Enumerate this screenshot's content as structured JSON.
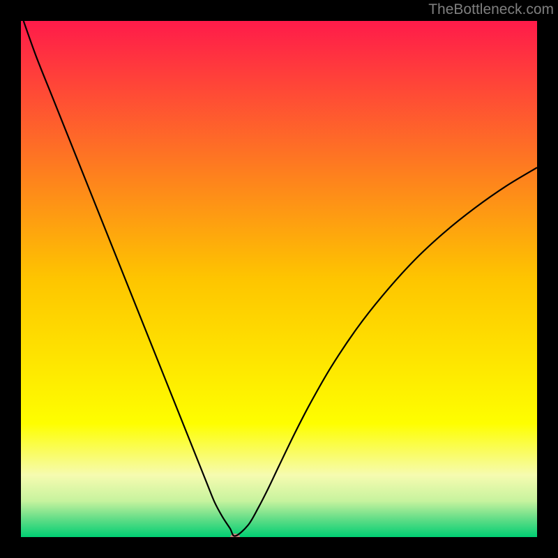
{
  "watermark": "TheBottleneck.com",
  "chart_data": {
    "type": "line",
    "title": "",
    "xlabel": "",
    "ylabel": "",
    "xlim": [
      0,
      100
    ],
    "ylim": [
      0,
      100
    ],
    "grid": false,
    "legend": false,
    "background_gradient_stops": [
      {
        "offset": 0.0,
        "color": "#ff1b4a"
      },
      {
        "offset": 0.5,
        "color": "#fec500"
      },
      {
        "offset": 0.78,
        "color": "#fefe00"
      },
      {
        "offset": 0.88,
        "color": "#f6fbb0"
      },
      {
        "offset": 0.93,
        "color": "#c7f39e"
      },
      {
        "offset": 0.965,
        "color": "#62dd87"
      },
      {
        "offset": 1.0,
        "color": "#00cf73"
      }
    ],
    "series": [
      {
        "name": "bottleneck-curve",
        "color": "#000000",
        "x": [
          0.5,
          3,
          6,
          9,
          12,
          15,
          18,
          21,
          24,
          27,
          30,
          32,
          34,
          36,
          37.5,
          39,
          40.5,
          41.5,
          44,
          46,
          48,
          50,
          53,
          56,
          60,
          65,
          70,
          76,
          82,
          88,
          94,
          100
        ],
        "y": [
          100,
          93,
          85.5,
          78,
          70.5,
          63,
          55.5,
          48,
          40.5,
          33,
          25.5,
          20.5,
          15.5,
          10.5,
          6.8,
          4.0,
          1.7,
          0.2,
          2.3,
          5.7,
          9.6,
          13.8,
          20.0,
          25.8,
          32.8,
          40.3,
          46.7,
          53.4,
          59.0,
          63.8,
          68.0,
          71.6
        ]
      }
    ],
    "marker": {
      "name": "optimal-point",
      "x": 41.5,
      "y": 0,
      "rx": 7,
      "ry": 5,
      "color": "#cf8181"
    }
  }
}
